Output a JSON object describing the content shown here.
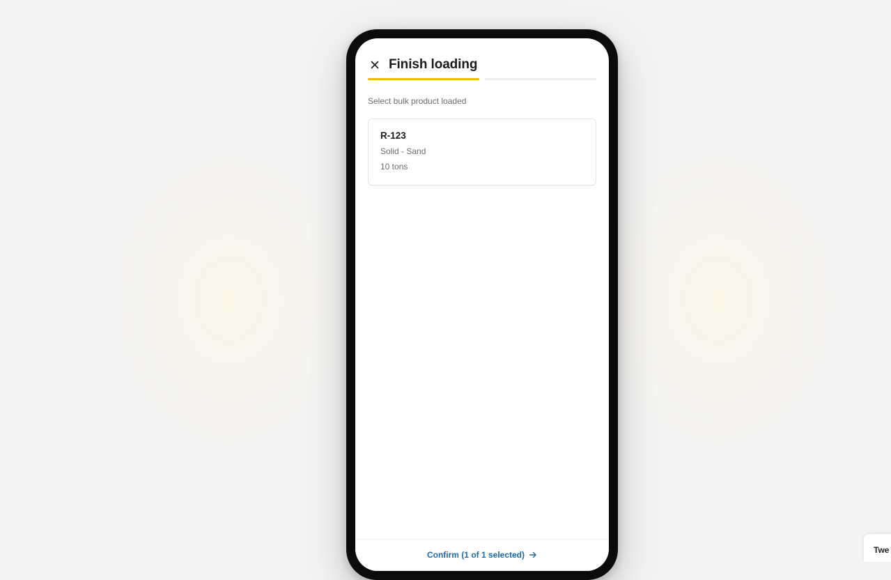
{
  "header": {
    "title": "Finish loading",
    "close_icon": "close-icon"
  },
  "progress": {
    "steps_total": 2,
    "current_step": 1,
    "accent_color": "#f2b90c"
  },
  "subtitle": "Select bulk product loaded",
  "products": [
    {
      "code": "R-123",
      "type": "Solid - Sand",
      "quantity": "10 tons"
    }
  ],
  "footer": {
    "confirm_label": "Confirm (1 of 1 selected)",
    "arrow_icon": "arrow-right-icon",
    "link_color": "#1c6aa5"
  },
  "tweaks_tab": {
    "label": "Twe"
  }
}
